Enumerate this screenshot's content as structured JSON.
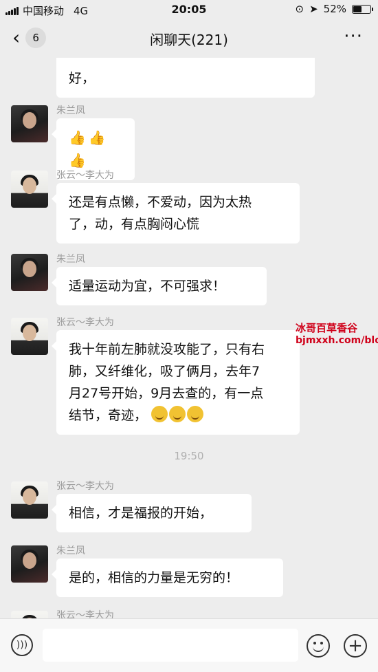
{
  "status_bar": {
    "carrier": "中国移动",
    "network": "4G",
    "time": "20:05",
    "battery_text": "52%",
    "battery_level": 0.52
  },
  "nav": {
    "back_icon": "chevron-left-icon",
    "unread_count": "6",
    "title": "闲聊天(221)",
    "more_icon": "ellipsis-icon"
  },
  "messages": [
    {
      "sender": "",
      "text": "好，"
    },
    {
      "sender": "朱兰凤",
      "text": "",
      "emoji": "thumbs-up-icon x3"
    },
    {
      "sender": "张云～李大为",
      "text_lines": [
        "还是有点懒，不爱动，因为太热",
        "了，动，有点胸闷心慌"
      ]
    },
    {
      "sender": "朱兰凤",
      "text": "适量运动为宜，不可强求！"
    },
    {
      "sender": "张云～李大为",
      "text_lines": [
        "我十年前左肺就没攻能了，只有右",
        "肺，又纤维化，吸了俩月，去年7",
        "月27号开始，9月去查的，有一点",
        "结节，奇迹，"
      ],
      "emoji": "grin-icon x3"
    },
    {
      "sender": "张云～李大为",
      "text": "相信，才是福报的开始，"
    },
    {
      "sender": "朱兰凤",
      "text": "是的，相信的力量是无穷的！"
    },
    {
      "sender": "张云～李大为",
      "text": ""
    }
  ],
  "time_separator": "19:50",
  "watermark": {
    "line1": "冰哥百草香谷",
    "line2": "bjmxxh.com/blo"
  },
  "input_bar": {
    "voice_icon": "voice-icon",
    "emoji_icon": "emoji-icon",
    "plus_icon": "plus-icon"
  }
}
